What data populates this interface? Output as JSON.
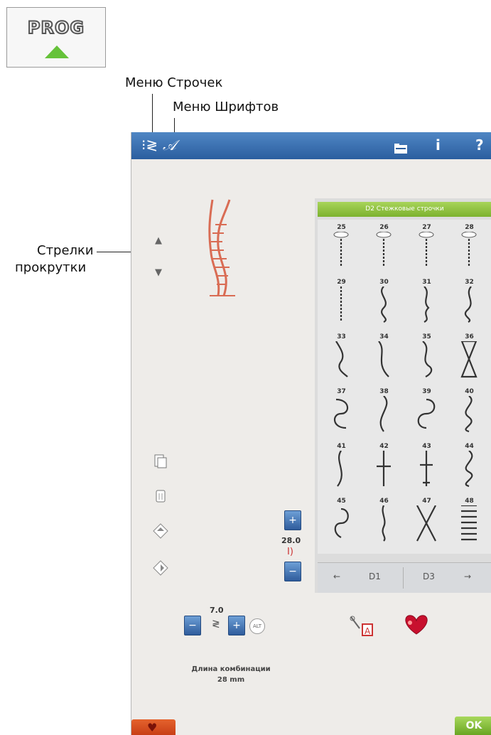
{
  "prog": {
    "label": "PROG"
  },
  "callouts": {
    "stitch_menu": "Меню Строчек",
    "font_menu": "Меню Шрифтов",
    "scroll_arrows_line1": "Стрелки",
    "scroll_arrows_line2": "прокрутки"
  },
  "topbar": {
    "icons": [
      "stitch-menu-icon",
      "font-menu-icon",
      "folder-icon",
      "info-icon",
      "help-icon"
    ]
  },
  "panel": {
    "header": "D2 Стежковые строчки",
    "stitches": [
      "25",
      "26",
      "27",
      "28",
      "29",
      "30",
      "31",
      "32",
      "33",
      "34",
      "35",
      "36",
      "37",
      "38",
      "39",
      "40",
      "41",
      "42",
      "43",
      "44",
      "45",
      "46",
      "47",
      "48"
    ],
    "prev_page": "D1",
    "next_page": "D3"
  },
  "controls": {
    "width_value": "28.0",
    "length_value": "7.0"
  },
  "info": {
    "label": "Длина комбинации",
    "value": "28 mm"
  },
  "buttons": {
    "ok": "OK"
  },
  "colors": {
    "topbar": "#2b5e9f",
    "accent_green": "#7cb22e",
    "heart": "#c83f16"
  }
}
